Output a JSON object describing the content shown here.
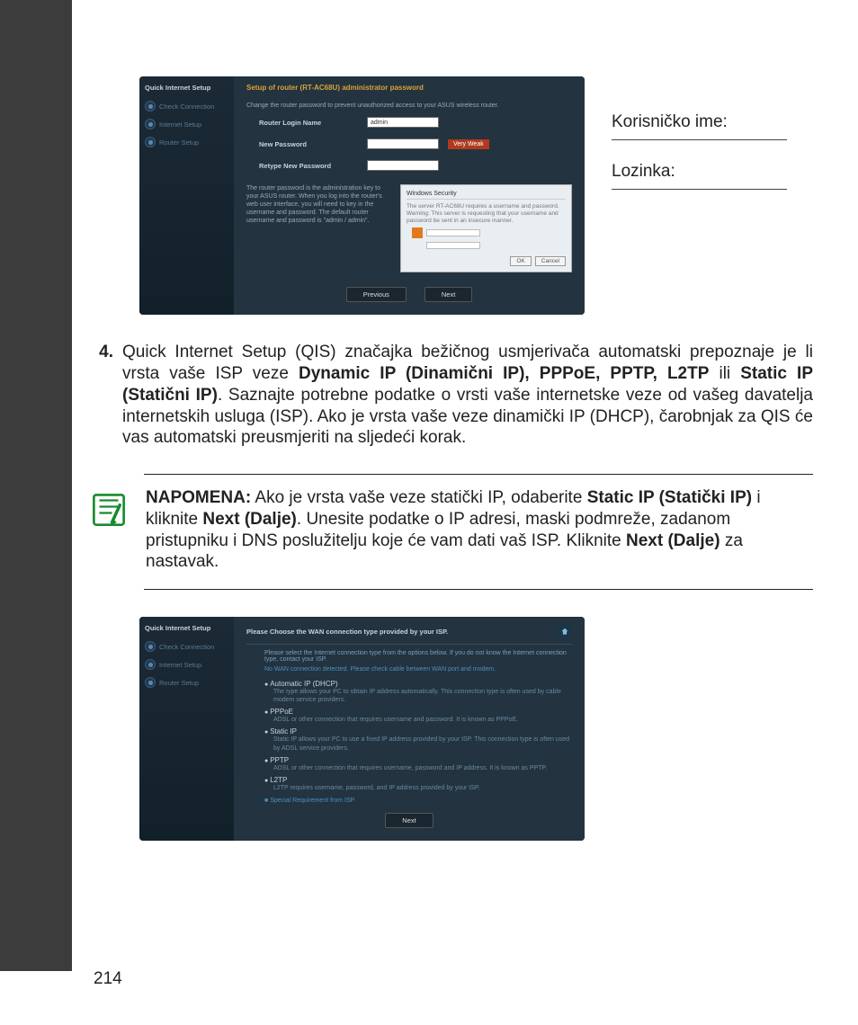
{
  "login_labels": {
    "username": "Korisničko ime:",
    "password": "Lozinka:"
  },
  "shot1": {
    "sidebar_title": "Quick Internet Setup",
    "steps": [
      "Check Connection",
      "Internet Setup",
      "Router Setup"
    ],
    "heading": "Setup of router (RT-AC68U) administrator password",
    "desc": "Change the router password to prevent unauthorized access to your ASUS wireless router.",
    "row1": "Router Login Name",
    "row1_val": "admin",
    "row2": "New Password",
    "row3": "Retype New Password",
    "badge": "Very Weak",
    "hint": "The router password is the administration key to your ASUS router. When you log into the router's web user interface, you will need to key in the username and password. The default router username and password is \"admin / admin\".",
    "dialog_hdr": "Windows Security",
    "dialog_txt": "The server RT-AC68U requires a username and password. Warning: This server is requesting that your username and password be sent in an insecure manner.",
    "dialog_ok": "OK",
    "dialog_cancel": "Cancel",
    "prev": "Previous",
    "next": "Next"
  },
  "step4": {
    "num": "4.",
    "pre": "Quick Internet Setup (QIS) značajka bežičnog usmjerivača automatski prepoznaje je li vrsta vaše ISP veze ",
    "bold1": "Dynamic IP (Dinamični IP), PPPoE, PPTP, L2TP",
    "mid": " ili ",
    "bold2": "Static IP (Statični IP)",
    "post": ". Saznajte potrebne podatke o vrsti vaše internetske veze od vašeg davatelja internetskih usluga (ISP). Ako je vrsta vaše veze dinamički IP (DHCP), čarobnjak za QIS će vas automatski preusmjeriti na sljedeći korak."
  },
  "note": {
    "label": "NAPOMENA:",
    "pre": "  Ako je vrsta vaše veze statički IP, odaberite ",
    "bold1": "Static IP (Statički IP)",
    "mid1": " i kliknite ",
    "bold2": "Next (Dalje)",
    "mid2": ". Unesite podatke o IP adresi, maski podmreže, zadanom pristupniku i DNS poslužitelju koje će vam dati vaš ISP. Kliknite ",
    "bold3": "Next (Dalje)",
    "post": " za nastavak."
  },
  "shot2": {
    "sidebar_title": "Quick Internet Setup",
    "steps": [
      "Check Connection",
      "Internet Setup",
      "Router Setup"
    ],
    "top": "Please Choose the WAN connection type provided by your ISP.",
    "intro": "Please select the Internet connection type from the options below. If you do not know the Internet connection type, contact your ISP.",
    "intro2": "No WAN connection detected. Please check cable between WAN port and modem.",
    "opts": [
      {
        "h": "Automatic IP (DHCP)",
        "d": "The type allows your PC to obtain IP address automatically. This connection type is often used by cable modem service providers."
      },
      {
        "h": "PPPoE",
        "d": "ADSL or other connection that requires username and password. It is known as PPPoE."
      },
      {
        "h": "Static IP",
        "d": "Static IP allows your PC to use a fixed IP address provided by your ISP. This connection type is often used by ADSL service providers."
      },
      {
        "h": "PPTP",
        "d": "ADSL or other connection that requires username, password and IP address. It is known as PPTP."
      },
      {
        "h": "L2TP",
        "d": "L2TP requires username, password, and IP address provided by your ISP."
      }
    ],
    "chk": "Special Requirement from ISP",
    "next": "Next"
  },
  "pagenum": "214"
}
